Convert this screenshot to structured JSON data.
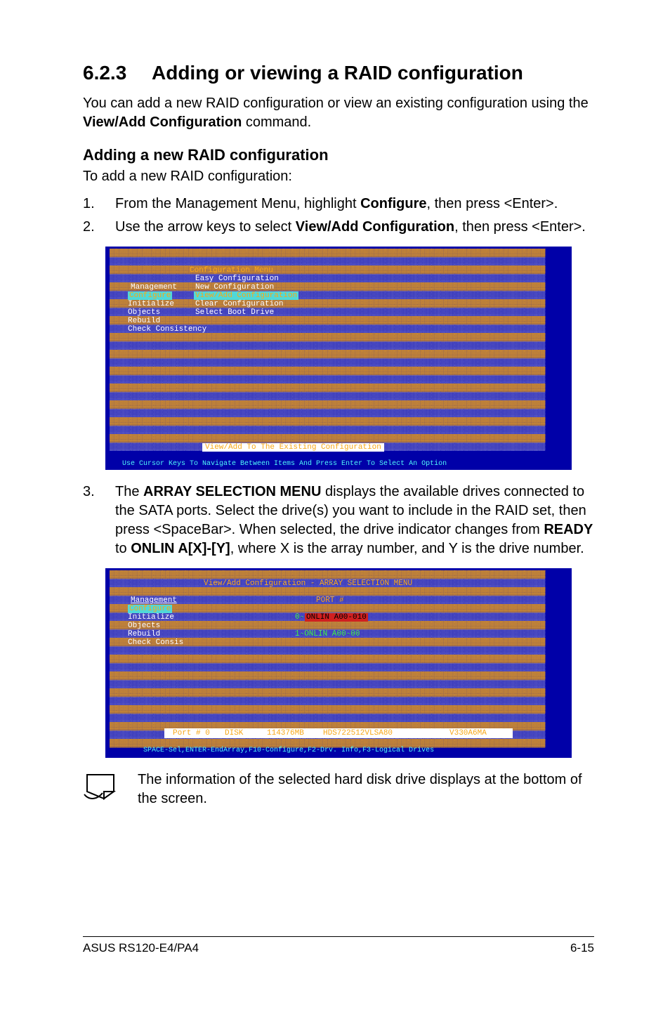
{
  "heading": {
    "num": "6.2.3",
    "title": "Adding or viewing a RAID configuration"
  },
  "intro": {
    "p1a": "You can add a new RAID configuration or view an existing configuration using the ",
    "p1b": "View/Add Configuration",
    "p1c": " command."
  },
  "sub1": {
    "title": "Adding a new RAID configuration",
    "lead": "To add a new RAID configuration:"
  },
  "steps": {
    "s1": {
      "n": "1.",
      "a": "From the Management Menu, highlight ",
      "b": "Configure",
      "c": ", then press <Enter>."
    },
    "s2": {
      "n": "2.",
      "a": "Use the arrow keys to select ",
      "b": "View/Add Configuration",
      "c": ", then press <Enter>."
    },
    "s3": {
      "n": "3.",
      "a": "The ",
      "b": "ARRAY SELECTION MENU",
      "c": " displays the available drives connected to the SATA ports. Select the drive(s) you want to include in the RAID set, then press <SpaceBar>. When selected, the drive indicator changes from ",
      "d": "READY",
      "e": "  to ",
      "f": "ONLIN A[X]-[Y]",
      "g": ", where X is the array number, and Y is the drive number."
    }
  },
  "bios1": {
    "title_bar": " Configuration Menu ",
    "menu": {
      "mgmt": "Management",
      "configure": "Configure",
      "init": "Initialize",
      "objects": "Objects",
      "rebuild": "Rebuild",
      "check": "Check Consistency"
    },
    "cfg_menu": {
      "easy": "Easy Configuration",
      "newc": "New Configuration",
      "viewadd": "View/Add Configuration",
      "clear": "Clear Configuration",
      "select_boot": "Select Boot Drive"
    },
    "status": " View/Add To The Existing Configuration ",
    "help": "Use Cursor Keys To Navigate Between Items And Press Enter To Select An Option"
  },
  "bios2": {
    "title_bar": "View/Add Configuration - ARRAY SELECTION MENU",
    "menu": {
      "mgmt": "Management",
      "configure": "Configure",
      "init": "Initialize",
      "objects": "Objects",
      "rebuild": "Rebuild",
      "check": "Check Consis"
    },
    "panel": {
      "port": "PORT #",
      "row0": "0-",
      "row0_hl": "ONLIN A00-010",
      "row1": "1-ONLIN A00-00"
    },
    "drive_info": {
      "prefix": "Port # 0",
      "disk": "DISK",
      "size": "114376MB",
      "model": "HDS722512VLSA80",
      "serial": "V330A6MA"
    },
    "help": "SPACE-Sel,ENTER-EndArray,F10-Configure,F2-Drv. Info,F3-Logical Drives"
  },
  "note": "The information of the selected hard disk drive displays at the bottom of the screen.",
  "footer": {
    "left": "ASUS RS120-E4/PA4",
    "right": "6-15"
  }
}
